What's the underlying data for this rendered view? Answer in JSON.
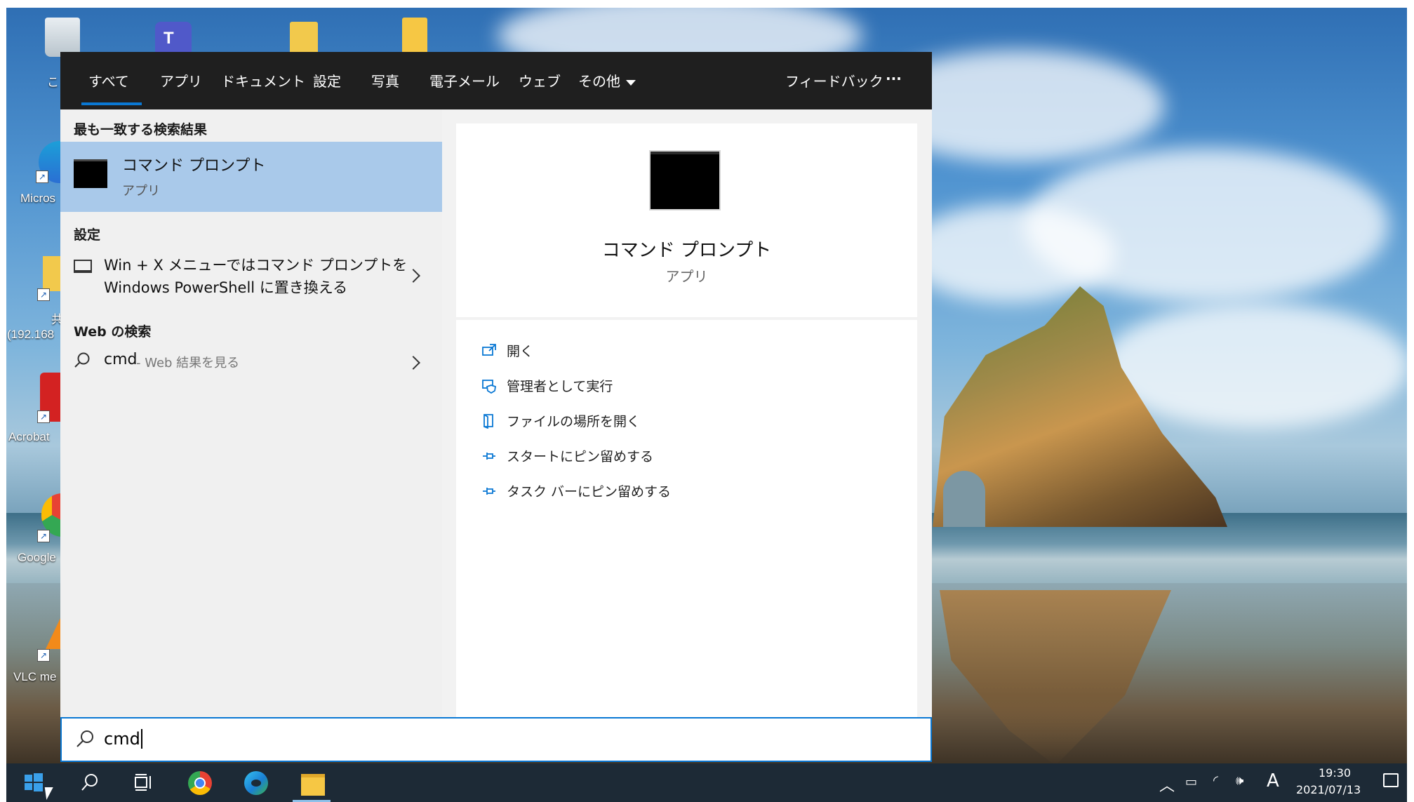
{
  "desktop": {
    "icons": [
      {
        "label": "こ"
      },
      {
        "label": "Micros"
      },
      {
        "label": "共"
      },
      {
        "label": "(192.168"
      },
      {
        "label": "Acrobat"
      },
      {
        "label": "Google"
      },
      {
        "label": "VLC me"
      }
    ]
  },
  "filter_tabs": [
    "すべて",
    "アプリ",
    "ドキュメント",
    "設定",
    "写真",
    "電子メール",
    "ウェブ",
    "その他"
  ],
  "feedback_label": "フィードバック",
  "more_options": "···",
  "results": {
    "best_match_header": "最も一致する検索結果",
    "best_match": {
      "title": "コマンド プロンプト",
      "subtitle": "アプリ"
    },
    "settings_header": "設定",
    "settings_item": {
      "line1": "Win + X メニューではコマンド プロンプトを",
      "line2": "Windows PowerShell に置き換える"
    },
    "web_header": "Web の検索",
    "web_item": {
      "query": "cmd",
      "suffix": " - Web 結果を見る"
    }
  },
  "preview": {
    "title": "コマンド プロンプト",
    "subtitle": "アプリ",
    "actions": [
      {
        "icon": "open-icon",
        "label": "開く"
      },
      {
        "icon": "run-as-admin-icon",
        "label": "管理者として実行"
      },
      {
        "icon": "file-location-icon",
        "label": "ファイルの場所を開く"
      },
      {
        "icon": "pin-icon",
        "label": "スタートにピン留めする"
      },
      {
        "icon": "pin-icon",
        "label": "タスク バーにピン留めする"
      }
    ]
  },
  "search": {
    "value": "cmd"
  },
  "taskbar": {
    "ime_mode": "A",
    "time": "19:30",
    "date": "2021/07/13"
  },
  "colors": {
    "accent": "#0a78d4",
    "selected": "#a9c9ea",
    "taskbar": "#1d2a36",
    "filter_bar": "#1f1f1f"
  }
}
